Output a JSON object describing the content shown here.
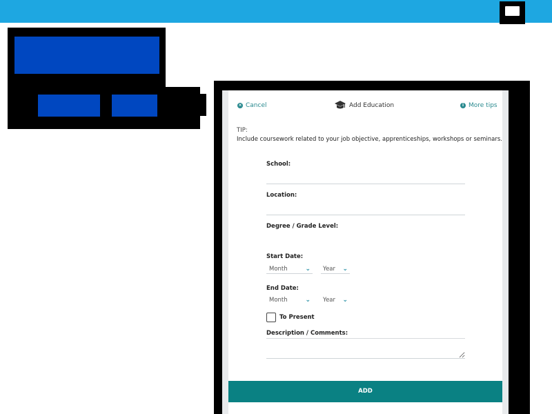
{
  "modal": {
    "cancel_label": "Cancel",
    "title": "Add Education",
    "more_tips_label": "More tips",
    "tip_heading": "TIP:",
    "tip_text": "Include coursework related to your job objective, apprenticeships, workshops or seminars.",
    "form": {
      "school_label": "School:",
      "school_value": "",
      "location_label": "Location:",
      "location_value": "",
      "degree_label": "Degree / Grade Level:",
      "degree_value": "",
      "start_label": "Start Date:",
      "start_month": "Month",
      "start_year": "Year",
      "end_label": "End Date:",
      "end_month": "Month",
      "end_year": "Year",
      "to_present_label": "To Present",
      "description_label": "Description / Comments:",
      "description_value": ""
    },
    "add_label": "ADD"
  },
  "colors": {
    "topbar": "#1ea7e1",
    "blocks": "#0047c0",
    "accent": "#0a8183"
  },
  "icons": {
    "cancel": "close-circle-icon",
    "title": "graduation-cap-icon",
    "tips": "info-circle-icon",
    "dropdown": "chevron-down-icon"
  }
}
